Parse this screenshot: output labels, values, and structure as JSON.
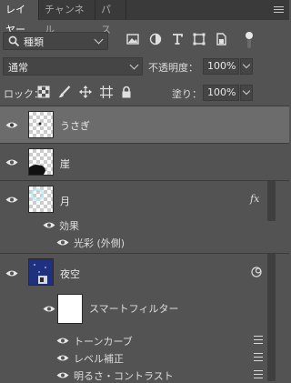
{
  "tabs": [
    "レイヤー",
    "チャンネル",
    "パス"
  ],
  "filter": {
    "kind_label": "種類"
  },
  "blend": {
    "mode": "通常",
    "opacity_label": "不透明度：",
    "opacity_value": "100%",
    "lock_label": "ロック：",
    "fill_label": "塗り：",
    "fill_value": "100%"
  },
  "layers": [
    {
      "name": "うさぎ",
      "selected": true
    },
    {
      "name": "崖"
    },
    {
      "name": "月",
      "fx": "fx",
      "effects_label": "効果",
      "effect": "光彩 (外側)"
    },
    {
      "name": "夜空",
      "smart_filter_label": "スマートフィルター",
      "filters": [
        "トーンカーブ",
        "レベル補正",
        "明るさ・コントラスト"
      ]
    }
  ],
  "colors": {
    "panel": "#535353",
    "tabbar": "#3a3a3a",
    "selected_row": "#6c6c6c"
  }
}
